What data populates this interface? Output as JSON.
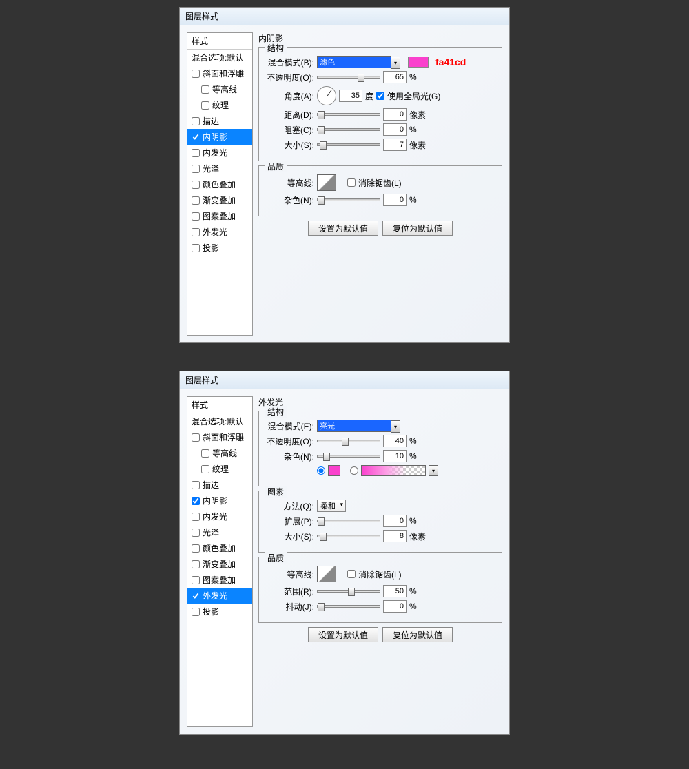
{
  "dialogs": [
    {
      "title": "图层样式",
      "styles_header": "样式",
      "blend_options": "混合选项:默认",
      "items": [
        {
          "label": "斜面和浮雕",
          "checked": false
        },
        {
          "label": "等高线",
          "checked": false,
          "sub": true
        },
        {
          "label": "纹理",
          "checked": false,
          "sub": true
        },
        {
          "label": "描边",
          "checked": false
        },
        {
          "label": "内阴影",
          "checked": true,
          "selected": true
        },
        {
          "label": "内发光",
          "checked": false
        },
        {
          "label": "光泽",
          "checked": false
        },
        {
          "label": "颜色叠加",
          "checked": false
        },
        {
          "label": "渐变叠加",
          "checked": false
        },
        {
          "label": "图案叠加",
          "checked": false
        },
        {
          "label": "外发光",
          "checked": false
        },
        {
          "label": "投影",
          "checked": false
        }
      ],
      "panel_title": "内阴影",
      "struct_label": "结构",
      "blend_mode_label": "混合模式(B):",
      "blend_mode_value": "滤色",
      "color_hex": "fa41cd",
      "opacity_label": "不透明度(O):",
      "opacity_value": "65",
      "pct": "%",
      "angle_label": "角度(A):",
      "angle_value": "35",
      "angle_unit": "度",
      "global_light_label": "使用全局光(G)",
      "distance_label": "距离(D):",
      "distance_value": "0",
      "px": "像素",
      "choke_label": "阻塞(C):",
      "choke_value": "0",
      "size_label": "大小(S):",
      "size_value": "7",
      "quality_label": "品质",
      "contour_label": "等高线:",
      "antialias_label": "消除锯齿(L)",
      "noise_label": "杂色(N):",
      "noise_value": "0",
      "btn_default": "设置为默认值",
      "btn_reset": "复位为默认值"
    },
    {
      "title": "图层样式",
      "styles_header": "样式",
      "blend_options": "混合选项:默认",
      "items": [
        {
          "label": "斜面和浮雕",
          "checked": false
        },
        {
          "label": "等高线",
          "checked": false,
          "sub": true
        },
        {
          "label": "纹理",
          "checked": false,
          "sub": true
        },
        {
          "label": "描边",
          "checked": false
        },
        {
          "label": "内阴影",
          "checked": true
        },
        {
          "label": "内发光",
          "checked": false
        },
        {
          "label": "光泽",
          "checked": false
        },
        {
          "label": "颜色叠加",
          "checked": false
        },
        {
          "label": "渐变叠加",
          "checked": false
        },
        {
          "label": "图案叠加",
          "checked": false
        },
        {
          "label": "外发光",
          "checked": true,
          "selected": true
        },
        {
          "label": "投影",
          "checked": false
        }
      ],
      "panel_title": "外发光",
      "struct_label": "结构",
      "blend_mode_label": "混合模式(E):",
      "blend_mode_value": "亮光",
      "opacity_label": "不透明度(O):",
      "opacity_value": "40",
      "pct": "%",
      "noise_label": "杂色(N):",
      "noise_value": "10",
      "elements_label": "图素",
      "method_label": "方法(Q):",
      "method_value": "柔和",
      "spread_label": "扩展(P):",
      "spread_value": "0",
      "size_label": "大小(S):",
      "size_value": "8",
      "px": "像素",
      "quality_label": "品质",
      "contour_label": "等高线:",
      "antialias_label": "消除锯齿(L)",
      "range_label": "范围(R):",
      "range_value": "50",
      "jitter_label": "抖动(J):",
      "jitter_value": "0",
      "btn_default": "设置为默认值",
      "btn_reset": "复位为默认值"
    }
  ]
}
